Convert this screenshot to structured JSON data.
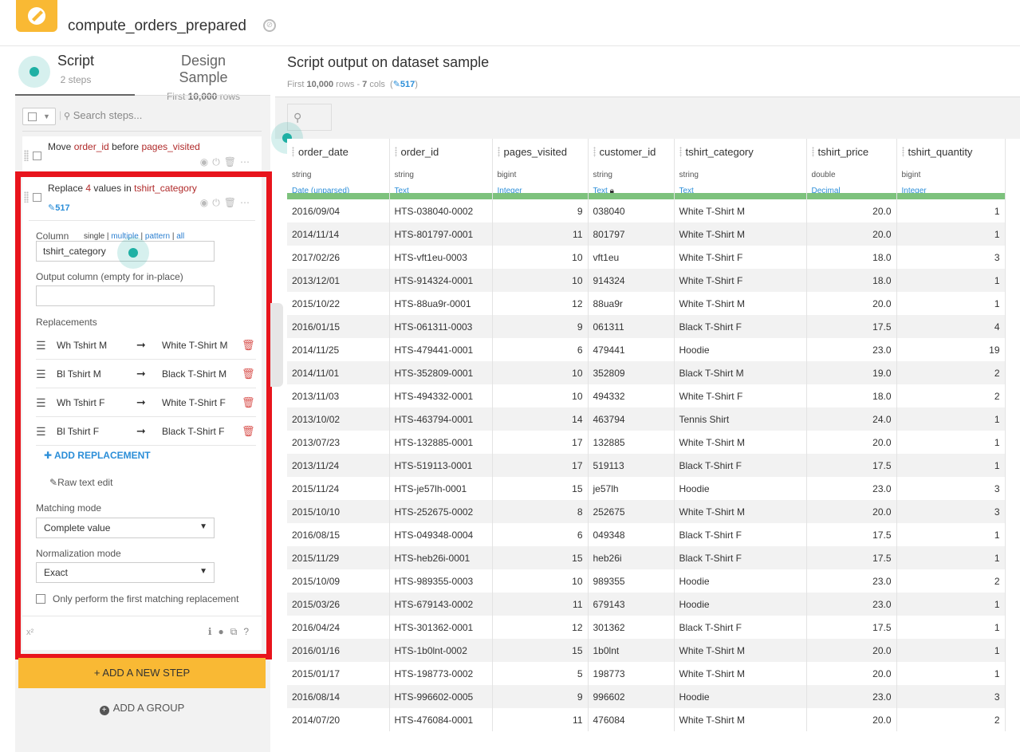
{
  "header": {
    "title": "compute_orders_prepared"
  },
  "left": {
    "tabs": [
      {
        "label": "Script",
        "sub": "2 steps"
      },
      {
        "label": "Design Sample",
        "sub_prefix": "First ",
        "sub_bold": "10,000",
        "sub_suffix": " rows"
      }
    ],
    "search_placeholder": "Search steps...",
    "step1": {
      "verb": "Move",
      "col1": "order_id",
      "mid": "before",
      "col2": "pages_visited"
    },
    "step2": {
      "verb": "Replace",
      "count": "4",
      "mid": "values in",
      "col": "tshirt_category",
      "badge": "517",
      "column_label": "Column",
      "modes": [
        "single",
        "multiple",
        "pattern",
        "all"
      ],
      "column_value": "tshirt_category",
      "output_label": "Output column (empty for in-place)",
      "output_value": "",
      "replacements_label": "Replacements",
      "replacements": [
        {
          "from": "Wh Tshirt M",
          "to": "White T-Shirt M"
        },
        {
          "from": "Bl Tshirt M",
          "to": "Black T-Shirt M"
        },
        {
          "from": "Wh Tshirt F",
          "to": "White T-Shirt F"
        },
        {
          "from": "Bl Tshirt F",
          "to": "Black T-Shirt F"
        }
      ],
      "add_replacement": "ADD REPLACEMENT",
      "raw_text_edit": "Raw text edit",
      "matching_label": "Matching mode",
      "matching_value": "Complete value",
      "normalization_label": "Normalization mode",
      "normalization_value": "Exact",
      "only_first": "Only perform the first matching replacement",
      "footer_left": "x²"
    },
    "add_step": "+ ADD A NEW STEP",
    "add_group": "ADD A GROUP"
  },
  "right": {
    "title": "Script output on dataset sample",
    "sub_prefix": "First ",
    "sub_bold1": "10,000",
    "sub_mid": " rows - ",
    "sub_bold2": "7",
    "sub_suffix": " cols",
    "badge": "517",
    "columns": [
      {
        "name": "order_date",
        "type": "string",
        "meaning": "Date (unparsed)"
      },
      {
        "name": "order_id",
        "type": "string",
        "meaning": "Text"
      },
      {
        "name": "pages_visited",
        "type": "bigint",
        "meaning": "Integer"
      },
      {
        "name": "customer_id",
        "type": "string",
        "meaning": "Text"
      },
      {
        "name": "tshirt_category",
        "type": "string",
        "meaning": "Text"
      },
      {
        "name": "tshirt_price",
        "type": "double",
        "meaning": "Decimal"
      },
      {
        "name": "tshirt_quantity",
        "type": "bigint",
        "meaning": "Integer"
      }
    ],
    "rows": [
      [
        "2016/09/04",
        "HTS-038040-0002",
        "9",
        "038040",
        "White T-Shirt M",
        "20.0",
        "1"
      ],
      [
        "2014/11/14",
        "HTS-801797-0001",
        "11",
        "801797",
        "White T-Shirt M",
        "20.0",
        "1"
      ],
      [
        "2017/02/26",
        "HTS-vft1eu-0003",
        "10",
        "vft1eu",
        "White T-Shirt F",
        "18.0",
        "3"
      ],
      [
        "2013/12/01",
        "HTS-914324-0001",
        "10",
        "914324",
        "White T-Shirt F",
        "18.0",
        "1"
      ],
      [
        "2015/10/22",
        "HTS-88ua9r-0001",
        "12",
        "88ua9r",
        "White T-Shirt M",
        "20.0",
        "1"
      ],
      [
        "2016/01/15",
        "HTS-061311-0003",
        "9",
        "061311",
        "Black T-Shirt F",
        "17.5",
        "4"
      ],
      [
        "2014/11/25",
        "HTS-479441-0001",
        "6",
        "479441",
        "Hoodie",
        "23.0",
        "19"
      ],
      [
        "2014/11/01",
        "HTS-352809-0001",
        "10",
        "352809",
        "Black T-Shirt M",
        "19.0",
        "2"
      ],
      [
        "2013/11/03",
        "HTS-494332-0001",
        "10",
        "494332",
        "White T-Shirt F",
        "18.0",
        "2"
      ],
      [
        "2013/10/02",
        "HTS-463794-0001",
        "14",
        "463794",
        "Tennis Shirt",
        "24.0",
        "1"
      ],
      [
        "2013/07/23",
        "HTS-132885-0001",
        "17",
        "132885",
        "White T-Shirt M",
        "20.0",
        "1"
      ],
      [
        "2013/11/24",
        "HTS-519113-0001",
        "17",
        "519113",
        "Black T-Shirt F",
        "17.5",
        "1"
      ],
      [
        "2015/11/24",
        "HTS-je57lh-0001",
        "15",
        "je57lh",
        "Hoodie",
        "23.0",
        "3"
      ],
      [
        "2015/10/10",
        "HTS-252675-0002",
        "8",
        "252675",
        "White T-Shirt M",
        "20.0",
        "3"
      ],
      [
        "2016/08/15",
        "HTS-049348-0004",
        "6",
        "049348",
        "Black T-Shirt F",
        "17.5",
        "1"
      ],
      [
        "2015/11/29",
        "HTS-heb26i-0001",
        "15",
        "heb26i",
        "Black T-Shirt F",
        "17.5",
        "1"
      ],
      [
        "2015/10/09",
        "HTS-989355-0003",
        "10",
        "989355",
        "Hoodie",
        "23.0",
        "2"
      ],
      [
        "2015/03/26",
        "HTS-679143-0002",
        "11",
        "679143",
        "Hoodie",
        "23.0",
        "1"
      ],
      [
        "2016/04/24",
        "HTS-301362-0001",
        "12",
        "301362",
        "Black T-Shirt F",
        "17.5",
        "1"
      ],
      [
        "2016/01/16",
        "HTS-1b0lnt-0002",
        "15",
        "1b0lnt",
        "White T-Shirt M",
        "20.0",
        "1"
      ],
      [
        "2015/01/17",
        "HTS-198773-0002",
        "5",
        "198773",
        "White T-Shirt M",
        "20.0",
        "1"
      ],
      [
        "2016/08/14",
        "HTS-996602-0005",
        "9",
        "996602",
        "Hoodie",
        "23.0",
        "3"
      ],
      [
        "2014/07/20",
        "HTS-476084-0001",
        "11",
        "476084",
        "White T-Shirt M",
        "20.0",
        "2"
      ]
    ]
  }
}
